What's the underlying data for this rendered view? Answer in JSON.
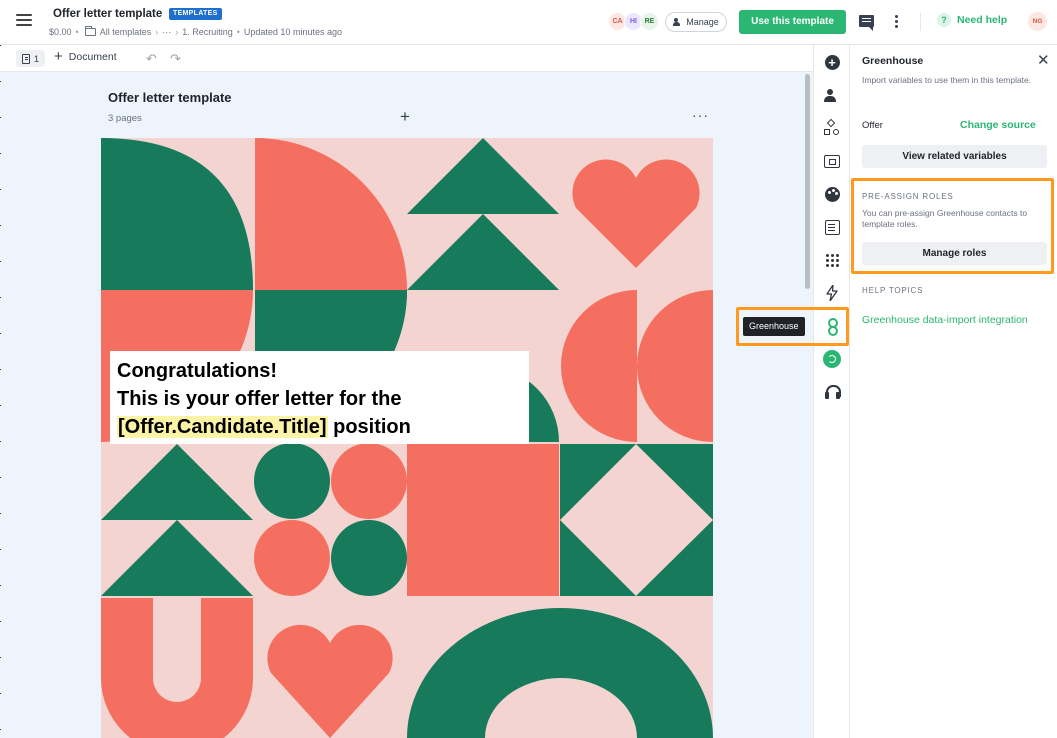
{
  "header": {
    "title": "Offer letter template",
    "badge": "TEMPLATES",
    "breadcrumb": {
      "price": "$0.00",
      "all_templates": "All templates",
      "ellipsis": "···",
      "folder": "1. Recruiting",
      "updated": "Updated 10 minutes ago"
    },
    "avatars": [
      "CA",
      "HI",
      "RE"
    ],
    "manage_label": "Manage",
    "use_template_label": "Use this template",
    "need_help_label": "Need help",
    "user_initials": "NG",
    "colors": {
      "primary": "#2bb673",
      "badge": "#1f6fce"
    }
  },
  "toolbar": {
    "page_count": "1",
    "add_document_label": "Document",
    "undo_icon": "undo-icon",
    "redo_icon": "redo-icon"
  },
  "canvas": {
    "doc_title": "Offer letter template",
    "page_count_label": "3 pages",
    "add_icon": "plus-icon",
    "more_icon": "more-horizontal-icon",
    "text_lines": [
      "Congratulations!",
      "This is your offer letter for the"
    ],
    "variable": "[Offer.Candidate.Title]",
    "after_variable": " position",
    "art_colors": {
      "background": "#f3d4d1",
      "green": "#177a5b",
      "coral": "#f56f60"
    }
  },
  "rail": {
    "icons": [
      "add-icon",
      "people-icon",
      "shapes-icon",
      "media-icon",
      "palette-icon",
      "form-icon",
      "apps-icon",
      "bolt-icon",
      "greenhouse-icon",
      "integration-icon",
      "headset-icon"
    ],
    "tooltip": "Greenhouse",
    "highlight_color": "#ff9a1f"
  },
  "panel": {
    "title": "Greenhouse",
    "description": "Import variables to use them in this template.",
    "offer_label": "Offer",
    "change_source_label": "Change source",
    "view_variables_label": "View related variables",
    "preassign_heading": "PRE-ASSIGN ROLES",
    "preassign_description": "You can pre-assign Greenhouse contacts to template roles.",
    "manage_roles_label": "Manage roles",
    "help_heading": "HELP TOPICS",
    "help_link": "Greenhouse data-import integration"
  }
}
